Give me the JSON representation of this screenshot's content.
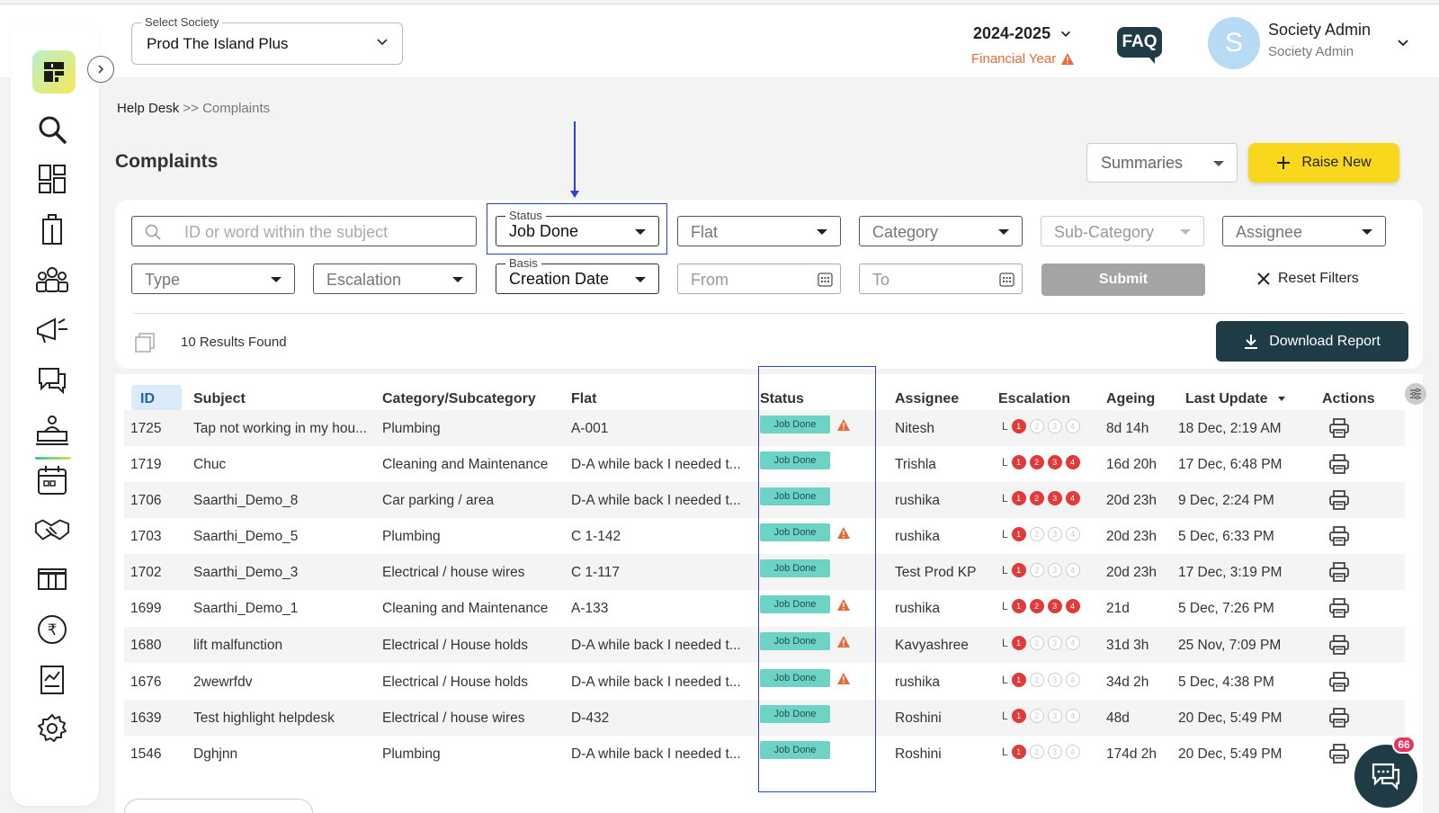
{
  "header": {
    "society_label": "Select Society",
    "society_value": "Prod The Island Plus",
    "year": "2024-2025",
    "financial_year": "Financial Year",
    "faq": "FAQ",
    "avatar_letter": "S",
    "user_name": "Society Admin",
    "user_role": "Society Admin"
  },
  "breadcrumb": {
    "root": "Help Desk",
    "sep": ">>",
    "current": "Complaints"
  },
  "page": {
    "title": "Complaints",
    "summaries": "Summaries",
    "raise_new": "Raise New"
  },
  "filters": {
    "search_placeholder": "ID or word within the subject",
    "status_label": "Status",
    "status_value": "Job Done",
    "flat": "Flat",
    "category": "Category",
    "sub_category": "Sub-Category",
    "assignee": "Assignee",
    "type": "Type",
    "escalation": "Escalation",
    "basis_label": "Basis",
    "basis_value": "Creation Date",
    "from": "From",
    "to": "To",
    "submit": "Submit",
    "reset": "Reset Filters"
  },
  "results": {
    "count_text": "10 Results Found",
    "download": "Download Report"
  },
  "table": {
    "headers": {
      "id": "ID",
      "subject": "Subject",
      "category": "Category/Subcategory",
      "flat": "Flat",
      "status": "Status",
      "assignee": "Assignee",
      "escalation": "Escalation",
      "ageing": "Ageing",
      "last_update": "Last Update",
      "actions": "Actions"
    },
    "escalation_prefix": "L",
    "rows": [
      {
        "id": "1725",
        "subject": "Tap not working in my hou...",
        "category": "Plumbing",
        "flat": "A-001",
        "status": "Job Done",
        "warn": true,
        "assignee": "Nitesh",
        "esc_level": 1,
        "ageing": "8d 14h",
        "last_update": "18 Dec, 2:19 AM"
      },
      {
        "id": "1719",
        "subject": "Chuc",
        "category": "Cleaning and Maintenance",
        "flat": "D-A while back I needed t...",
        "status": "Job Done",
        "warn": false,
        "assignee": "Trishla",
        "esc_level": 4,
        "ageing": "16d 20h",
        "last_update": "17 Dec, 6:48 PM"
      },
      {
        "id": "1706",
        "subject": "Saarthi_Demo_8",
        "category": "Car parking / area",
        "flat": "D-A while back I needed t...",
        "status": "Job Done",
        "warn": false,
        "assignee": "rushika",
        "esc_level": 4,
        "ageing": "20d 23h",
        "last_update": "9 Dec, 2:24 PM"
      },
      {
        "id": "1703",
        "subject": "Saarthi_Demo_5",
        "category": "Plumbing",
        "flat": "C 1-142",
        "status": "Job Done",
        "warn": true,
        "assignee": "rushika",
        "esc_level": 1,
        "ageing": "20d 23h",
        "last_update": "5 Dec, 6:33 PM"
      },
      {
        "id": "1702",
        "subject": "Saarthi_Demo_3",
        "category": "Electrical / house wires",
        "flat": "C 1-117",
        "status": "Job Done",
        "warn": false,
        "assignee": "Test Prod KP",
        "esc_level": 1,
        "ageing": "20d 23h",
        "last_update": "17 Dec, 3:19 PM"
      },
      {
        "id": "1699",
        "subject": "Saarthi_Demo_1",
        "category": "Cleaning and Maintenance",
        "flat": "A-133",
        "status": "Job Done",
        "warn": true,
        "assignee": "rushika",
        "esc_level": 4,
        "ageing": "21d",
        "last_update": "5 Dec, 7:26 PM"
      },
      {
        "id": "1680",
        "subject": "lift malfunction",
        "category": "Electrical / House holds",
        "flat": "D-A while back I needed t...",
        "status": "Job Done",
        "warn": true,
        "assignee": "Kavyashree",
        "esc_level": 1,
        "ageing": "31d 3h",
        "last_update": "25 Nov, 7:09 PM"
      },
      {
        "id": "1676",
        "subject": "2wewrfdv",
        "category": "Electrical / House holds",
        "flat": "D-A while back I needed t...",
        "status": "Job Done",
        "warn": true,
        "assignee": "rushika",
        "esc_level": 1,
        "ageing": "34d 2h",
        "last_update": "5 Dec, 4:38 PM"
      },
      {
        "id": "1639",
        "subject": "Test highlight helpdesk",
        "category": "Electrical / house wires",
        "flat": "D-432",
        "status": "Job Done",
        "warn": false,
        "assignee": "Roshini",
        "esc_level": 1,
        "ageing": "48d",
        "last_update": "20 Dec, 5:49 PM"
      },
      {
        "id": "1546",
        "subject": "Dghjnn",
        "category": "Plumbing",
        "flat": "D-A while back I needed t...",
        "status": "Job Done",
        "warn": false,
        "assignee": "Roshini",
        "esc_level": 1,
        "ageing": "174d 2h",
        "last_update": "20 Dec, 5:49 PM"
      }
    ]
  },
  "chat": {
    "badge": "66"
  },
  "colors": {
    "accent_dark": "#1f3c46",
    "raise_yellow": "#f9d71c",
    "status_teal": "#6dd3c4",
    "escalation_red": "#e13a3a",
    "highlight_blue": "#2a3fd6",
    "financial_orange": "#e86a3a"
  },
  "icons": [
    "logo-icon",
    "search-icon",
    "dashboard-icon",
    "building-icon",
    "community-icon",
    "announcement-icon",
    "chat-icon",
    "helpdesk-icon",
    "calendar-icon",
    "handshake-icon",
    "amenities-icon",
    "rupee-icon",
    "report-icon",
    "settings-icon",
    "print-icon",
    "download-icon",
    "warning-icon"
  ]
}
